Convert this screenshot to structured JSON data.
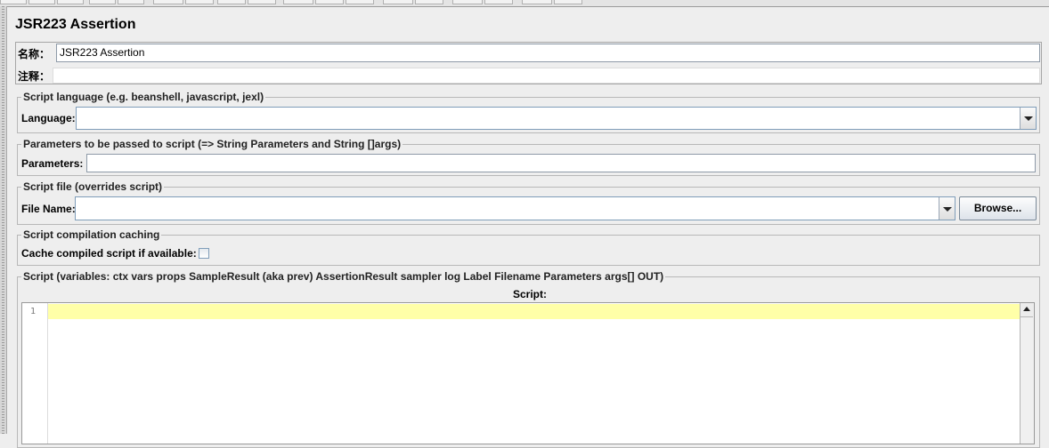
{
  "panel": {
    "title": "JSR223 Assertion"
  },
  "name_field": {
    "label": "名称：",
    "value": "JSR223 Assertion"
  },
  "comment_field": {
    "label": "注释：",
    "value": ""
  },
  "script_language": {
    "legend": "Script language (e.g. beanshell, javascript, jexl)",
    "label": "Language:",
    "selected": ""
  },
  "parameters": {
    "legend": "Parameters to be passed to script (=> String Parameters and String []args)",
    "label": "Parameters:",
    "value": ""
  },
  "script_file": {
    "legend": "Script file (overrides script)",
    "label": "File Name:",
    "value": "",
    "browse_label": "Browse..."
  },
  "caching": {
    "legend": "Script compilation caching",
    "label": "Cache compiled script if available:",
    "checked": false
  },
  "script": {
    "legend": "Script (variables: ctx vars props SampleResult (aka prev) AssertionResult sampler log Label Filename Parameters args[] OUT)",
    "label": "Script:",
    "line_numbers": [
      "1"
    ],
    "current_line_color": "#ffffa8"
  }
}
